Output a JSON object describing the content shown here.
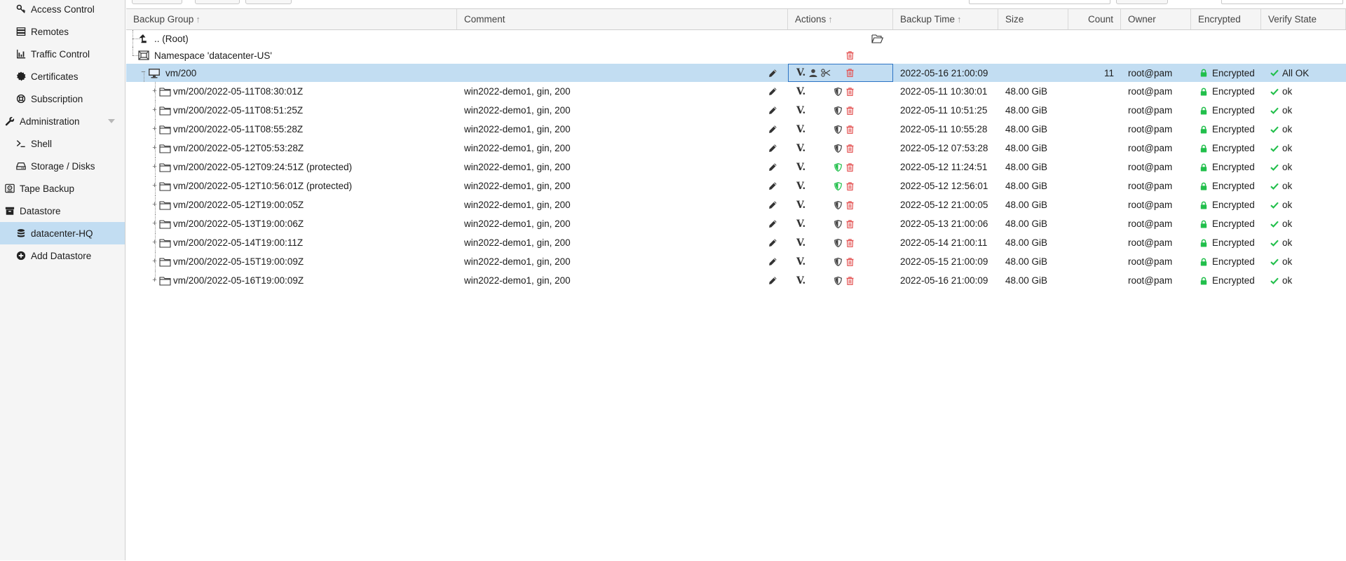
{
  "sidebar": {
    "items": [
      {
        "label": "Access Control",
        "icon": "key-icon",
        "indent": 1
      },
      {
        "label": "Remotes",
        "icon": "server-icon",
        "indent": 1
      },
      {
        "label": "Traffic Control",
        "icon": "chart-icon",
        "indent": 1
      },
      {
        "label": "Certificates",
        "icon": "certificate-icon",
        "indent": 1
      },
      {
        "label": "Subscription",
        "icon": "support-icon",
        "indent": 1
      },
      {
        "label": "Administration",
        "icon": "wrench-icon",
        "indent": 0
      },
      {
        "label": "Shell",
        "icon": "terminal-icon",
        "indent": 1
      },
      {
        "label": "Storage / Disks",
        "icon": "hdd-icon",
        "indent": 1
      },
      {
        "label": "Tape Backup",
        "icon": "tape-icon",
        "indent": 0
      },
      {
        "label": "Datastore",
        "icon": "archive-icon",
        "indent": 0
      },
      {
        "label": "datacenter-HQ",
        "icon": "database-icon",
        "indent": 1
      },
      {
        "label": "Add Datastore",
        "icon": "plus-circle-icon",
        "indent": 1
      }
    ]
  },
  "columns": {
    "backup_group": "Backup Group",
    "comment": "Comment",
    "actions": "Actions",
    "backup_time": "Backup Time",
    "size": "Size",
    "count": "Count",
    "owner": "Owner",
    "encrypted": "Encrypted",
    "verify_state": "Verify State"
  },
  "tree": {
    "root_label": ".. (Root)",
    "namespace_label": "Namespace 'datacenter-US'",
    "group": {
      "label": "vm/200",
      "verify_label": "V.",
      "backup_time": "2022-05-16 21:00:09",
      "count": "11",
      "owner": "root@pam",
      "encrypted": "Encrypted",
      "verify_state": "All OK"
    }
  },
  "snapshots": [
    {
      "name": "vm/200/2022-05-11T08:30:01Z",
      "comment": "win2022-demo1, gin, 200",
      "verify": "V.",
      "protected": false,
      "time": "2022-05-11 10:30:01",
      "size": "48.00 GiB",
      "owner": "root@pam",
      "encrypted": "Encrypted",
      "state": "ok"
    },
    {
      "name": "vm/200/2022-05-11T08:51:25Z",
      "comment": "win2022-demo1, gin, 200",
      "verify": "V.",
      "protected": false,
      "time": "2022-05-11 10:51:25",
      "size": "48.00 GiB",
      "owner": "root@pam",
      "encrypted": "Encrypted",
      "state": "ok"
    },
    {
      "name": "vm/200/2022-05-11T08:55:28Z",
      "comment": "win2022-demo1, gin, 200",
      "verify": "V.",
      "protected": false,
      "time": "2022-05-11 10:55:28",
      "size": "48.00 GiB",
      "owner": "root@pam",
      "encrypted": "Encrypted",
      "state": "ok"
    },
    {
      "name": "vm/200/2022-05-12T05:53:28Z",
      "comment": "win2022-demo1, gin, 200",
      "verify": "V.",
      "protected": false,
      "time": "2022-05-12 07:53:28",
      "size": "48.00 GiB",
      "owner": "root@pam",
      "encrypted": "Encrypted",
      "state": "ok"
    },
    {
      "name": "vm/200/2022-05-12T09:24:51Z (protected)",
      "comment": "win2022-demo1, gin, 200",
      "verify": "V.",
      "protected": true,
      "time": "2022-05-12 11:24:51",
      "size": "48.00 GiB",
      "owner": "root@pam",
      "encrypted": "Encrypted",
      "state": "ok"
    },
    {
      "name": "vm/200/2022-05-12T10:56:01Z (protected)",
      "comment": "win2022-demo1, gin, 200",
      "verify": "V.",
      "protected": true,
      "time": "2022-05-12 12:56:01",
      "size": "48.00 GiB",
      "owner": "root@pam",
      "encrypted": "Encrypted",
      "state": "ok"
    },
    {
      "name": "vm/200/2022-05-12T19:00:05Z",
      "comment": "win2022-demo1, gin, 200",
      "verify": "V.",
      "protected": false,
      "time": "2022-05-12 21:00:05",
      "size": "48.00 GiB",
      "owner": "root@pam",
      "encrypted": "Encrypted",
      "state": "ok"
    },
    {
      "name": "vm/200/2022-05-13T19:00:06Z",
      "comment": "win2022-demo1, gin, 200",
      "verify": "V.",
      "protected": false,
      "time": "2022-05-13 21:00:06",
      "size": "48.00 GiB",
      "owner": "root@pam",
      "encrypted": "Encrypted",
      "state": "ok"
    },
    {
      "name": "vm/200/2022-05-14T19:00:11Z",
      "comment": "win2022-demo1, gin, 200",
      "verify": "V.",
      "protected": false,
      "time": "2022-05-14 21:00:11",
      "size": "48.00 GiB",
      "owner": "root@pam",
      "encrypted": "Encrypted",
      "state": "ok"
    },
    {
      "name": "vm/200/2022-05-15T19:00:09Z",
      "comment": "win2022-demo1, gin, 200",
      "verify": "V.",
      "protected": false,
      "time": "2022-05-15 21:00:09",
      "size": "48.00 GiB",
      "owner": "root@pam",
      "encrypted": "Encrypted",
      "state": "ok"
    },
    {
      "name": "vm/200/2022-05-16T19:00:09Z",
      "comment": "win2022-demo1, gin, 200",
      "verify": "V.",
      "protected": false,
      "time": "2022-05-16 21:00:09",
      "size": "48.00 GiB",
      "owner": "root@pam",
      "encrypted": "Encrypted",
      "state": "ok"
    }
  ],
  "colors": {
    "selection": "#c2ddf2",
    "ok_green": "#21bf4b",
    "delete_red": "#e45656",
    "protected_green": "#21bf4b"
  }
}
